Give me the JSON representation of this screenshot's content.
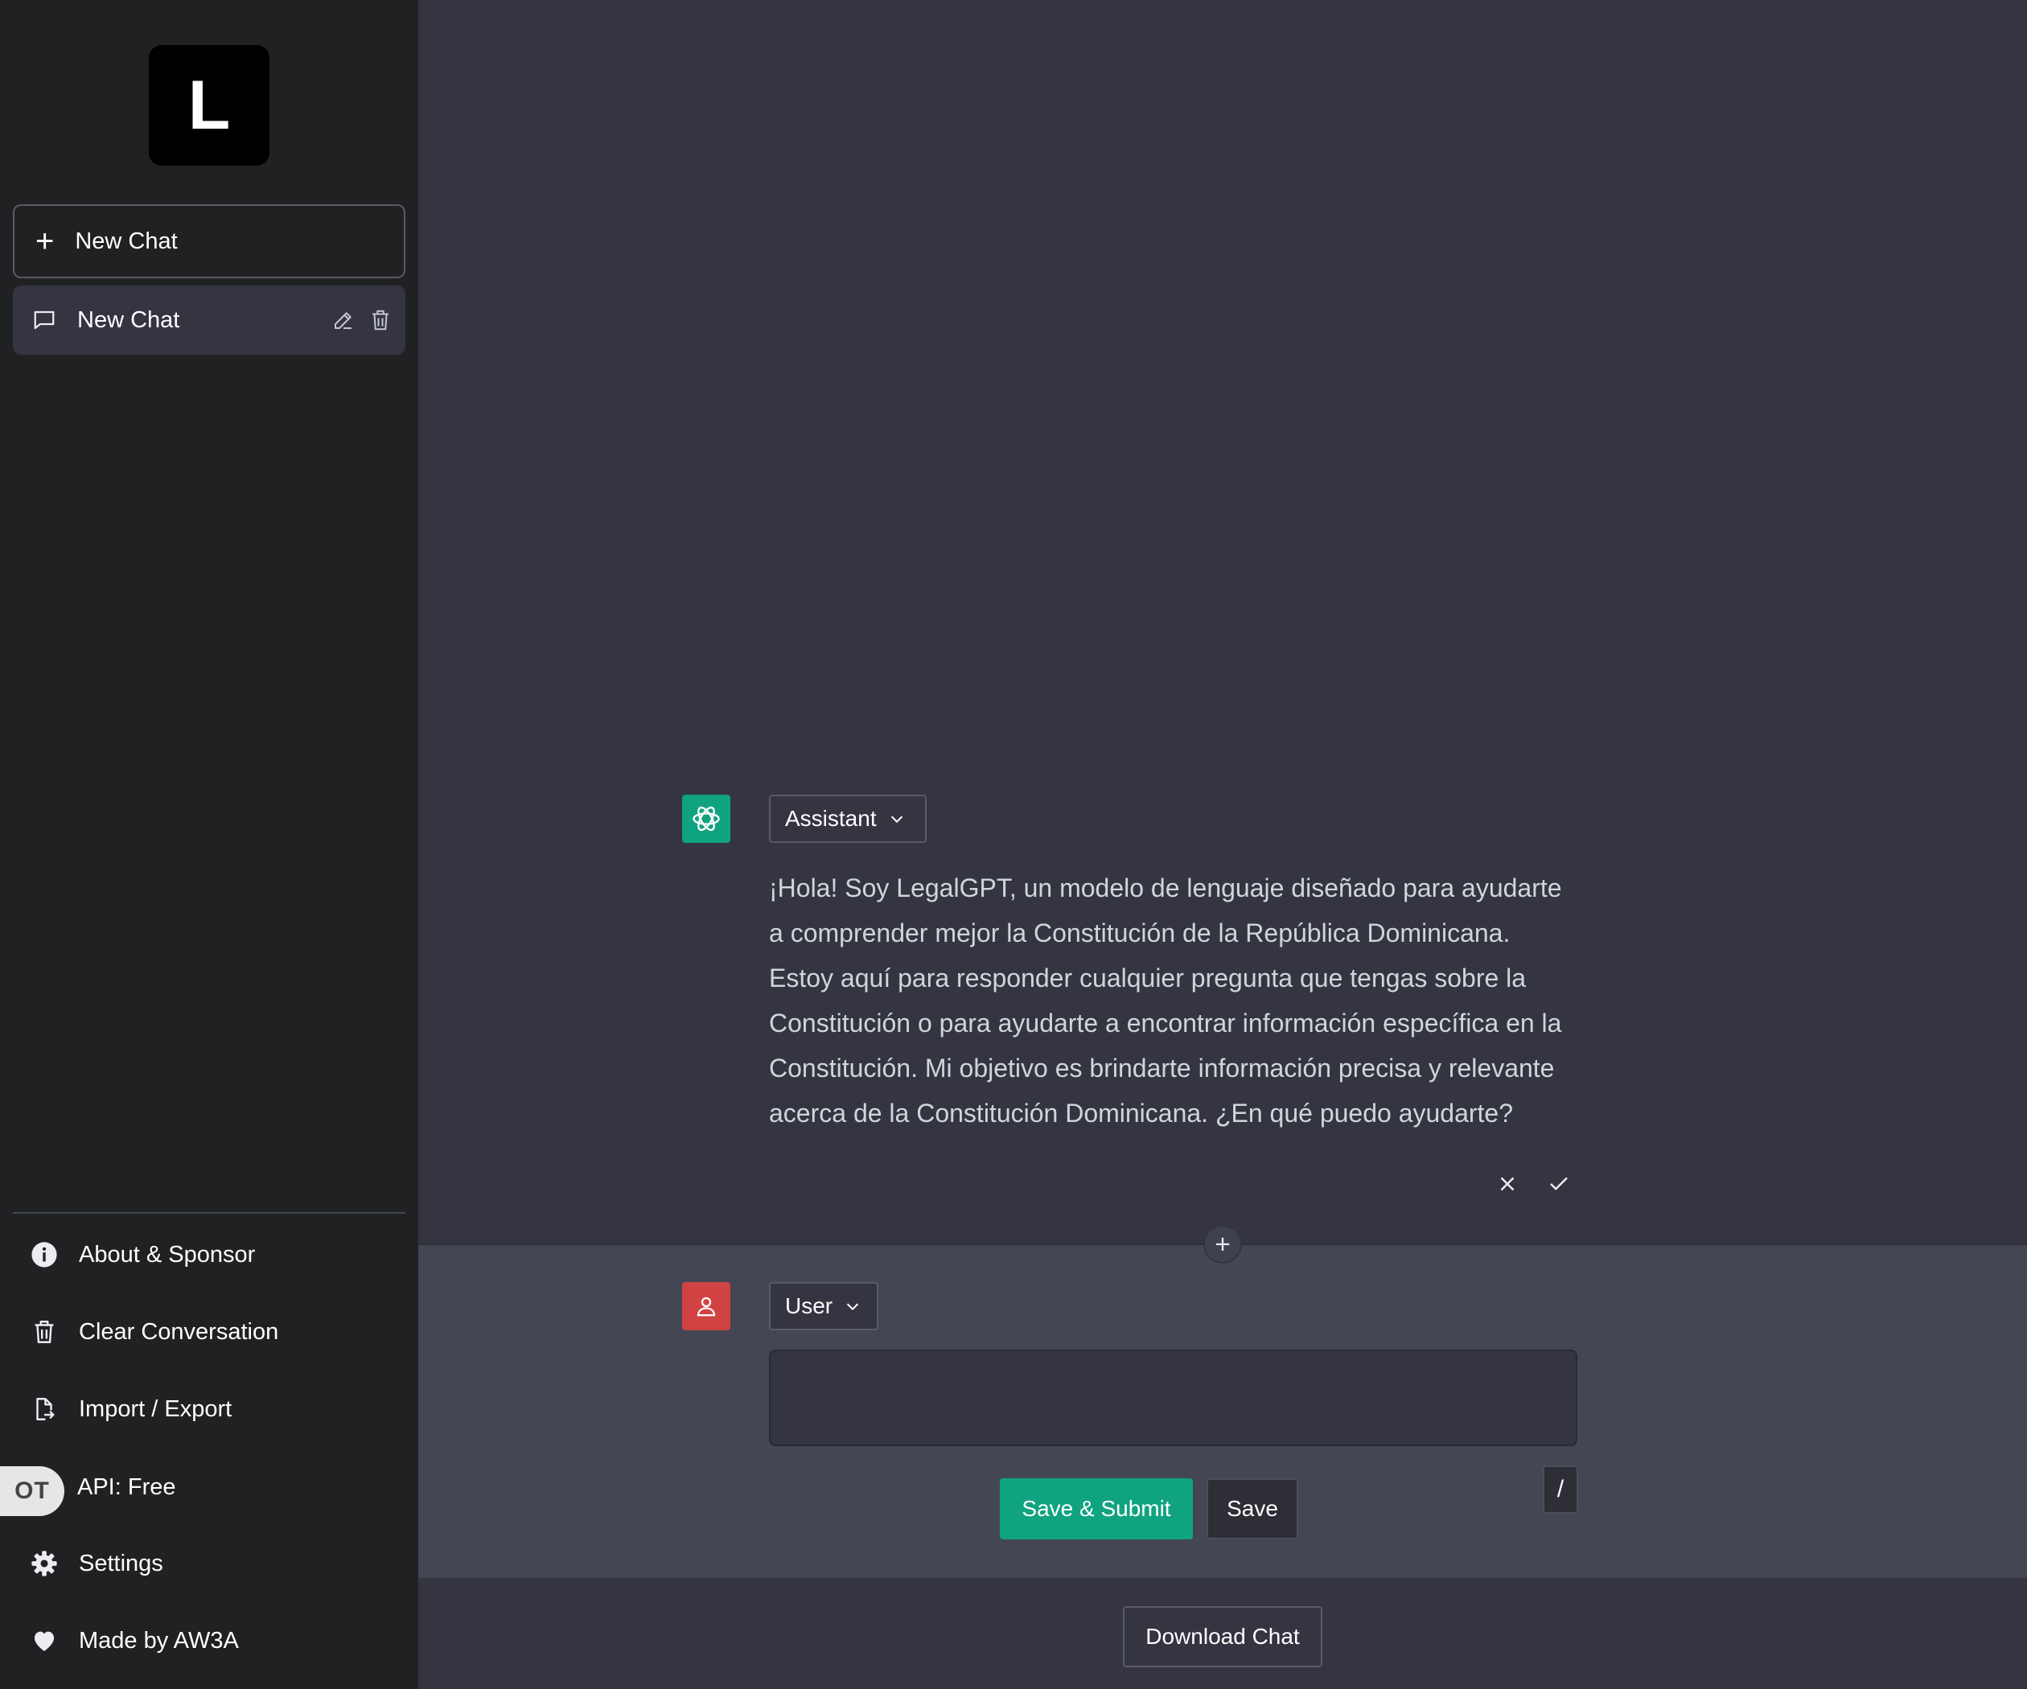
{
  "sidebar": {
    "logo_letter": "L",
    "new_chat_label": "New Chat",
    "conversations": [
      {
        "label": "New Chat"
      }
    ],
    "menu": {
      "about": "About & Sponsor",
      "clear": "Clear Conversation",
      "import_export": "Import / Export",
      "api_toggle": "OT",
      "api": "API: Free",
      "settings": "Settings",
      "made_by": "Made by AW3A"
    }
  },
  "chat": {
    "assistant": {
      "role": "Assistant",
      "message": "¡Hola! Soy LegalGPT, un modelo de lenguaje diseñado para ayudarte a comprender mejor la Constitución de la República Dominicana. Estoy aquí para responder cualquier pregunta que tengas sobre la Constitución o para ayudarte a encontrar información específica en la Constitución. Mi objetivo es brindarte información precisa y relevante acerca de la Constitución Dominicana. ¿En qué puedo ayudarte?"
    },
    "user": {
      "role": "User",
      "input_value": ""
    },
    "buttons": {
      "save_submit": "Save & Submit",
      "save": "Save",
      "slash": "/",
      "download": "Download Chat"
    }
  },
  "colors": {
    "accent": "#10a37f",
    "user_avatar": "#d14343",
    "sidebar_bg": "#202123",
    "main_bg": "#343541",
    "user_section_bg": "#444654"
  }
}
